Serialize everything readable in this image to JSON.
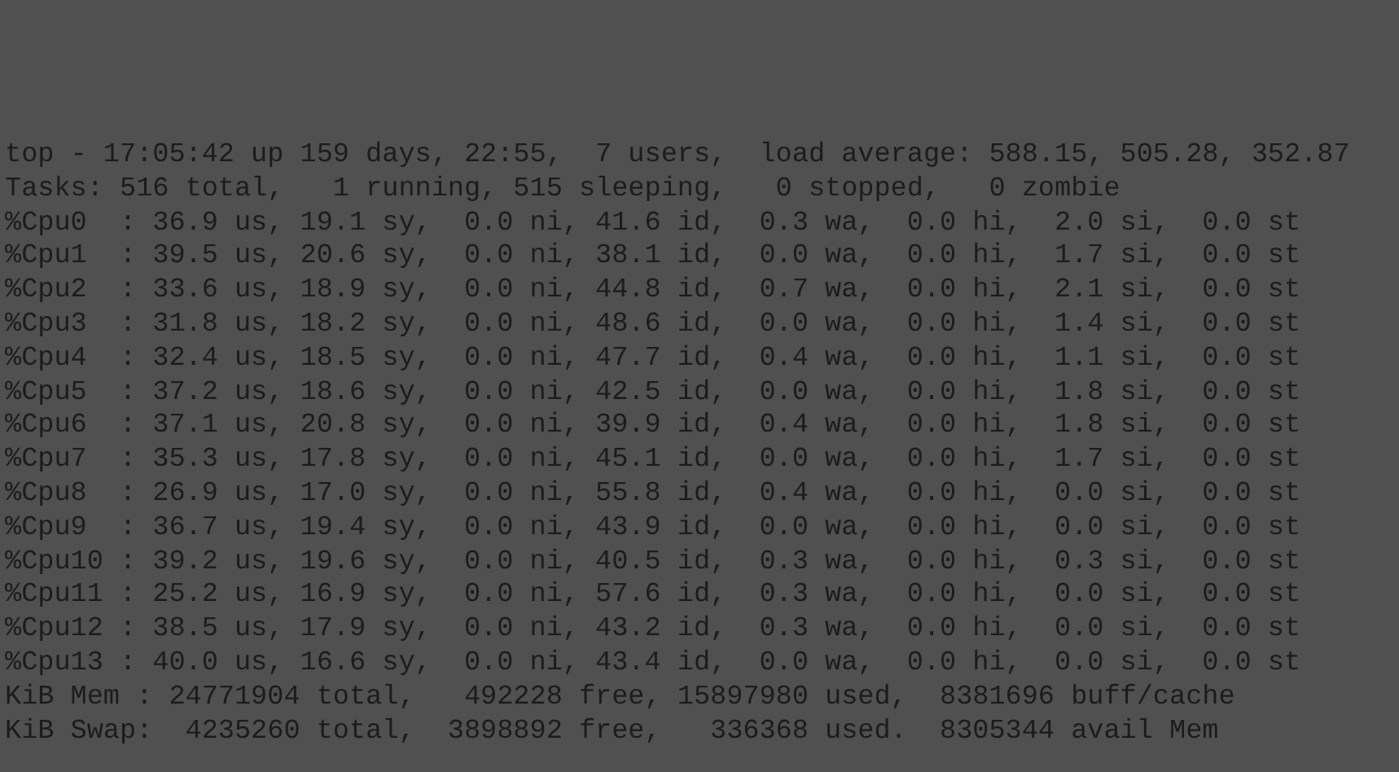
{
  "terminal": {
    "lines": [
      "top - 17:05:42 up 159 days, 22:55,  7 users,  load average: 588.15, 505.28, 352.87",
      "Tasks: 516 total,   1 running, 515 sleeping,   0 stopped,   0 zombie",
      "%Cpu0  : 36.9 us, 19.1 sy,  0.0 ni, 41.6 id,  0.3 wa,  0.0 hi,  2.0 si,  0.0 st",
      "%Cpu1  : 39.5 us, 20.6 sy,  0.0 ni, 38.1 id,  0.0 wa,  0.0 hi,  1.7 si,  0.0 st",
      "%Cpu2  : 33.6 us, 18.9 sy,  0.0 ni, 44.8 id,  0.7 wa,  0.0 hi,  2.1 si,  0.0 st",
      "%Cpu3  : 31.8 us, 18.2 sy,  0.0 ni, 48.6 id,  0.0 wa,  0.0 hi,  1.4 si,  0.0 st",
      "%Cpu4  : 32.4 us, 18.5 sy,  0.0 ni, 47.7 id,  0.4 wa,  0.0 hi,  1.1 si,  0.0 st",
      "%Cpu5  : 37.2 us, 18.6 sy,  0.0 ni, 42.5 id,  0.0 wa,  0.0 hi,  1.8 si,  0.0 st",
      "%Cpu6  : 37.1 us, 20.8 sy,  0.0 ni, 39.9 id,  0.4 wa,  0.0 hi,  1.8 si,  0.0 st",
      "%Cpu7  : 35.3 us, 17.8 sy,  0.0 ni, 45.1 id,  0.0 wa,  0.0 hi,  1.7 si,  0.0 st",
      "%Cpu8  : 26.9 us, 17.0 sy,  0.0 ni, 55.8 id,  0.4 wa,  0.0 hi,  0.0 si,  0.0 st",
      "%Cpu9  : 36.7 us, 19.4 sy,  0.0 ni, 43.9 id,  0.0 wa,  0.0 hi,  0.0 si,  0.0 st",
      "%Cpu10 : 39.2 us, 19.6 sy,  0.0 ni, 40.5 id,  0.3 wa,  0.0 hi,  0.3 si,  0.0 st",
      "%Cpu11 : 25.2 us, 16.9 sy,  0.0 ni, 57.6 id,  0.3 wa,  0.0 hi,  0.0 si,  0.0 st",
      "%Cpu12 : 38.5 us, 17.9 sy,  0.0 ni, 43.2 id,  0.3 wa,  0.0 hi,  0.0 si,  0.0 st",
      "%Cpu13 : 40.0 us, 16.6 sy,  0.0 ni, 43.4 id,  0.0 wa,  0.0 hi,  0.0 si,  0.0 st",
      "KiB Mem : 24771904 total,   492228 free, 15897980 used,  8381696 buff/cache",
      "KiB Swap:  4235260 total,  3898892 free,   336368 used.  8305344 avail Mem"
    ]
  }
}
